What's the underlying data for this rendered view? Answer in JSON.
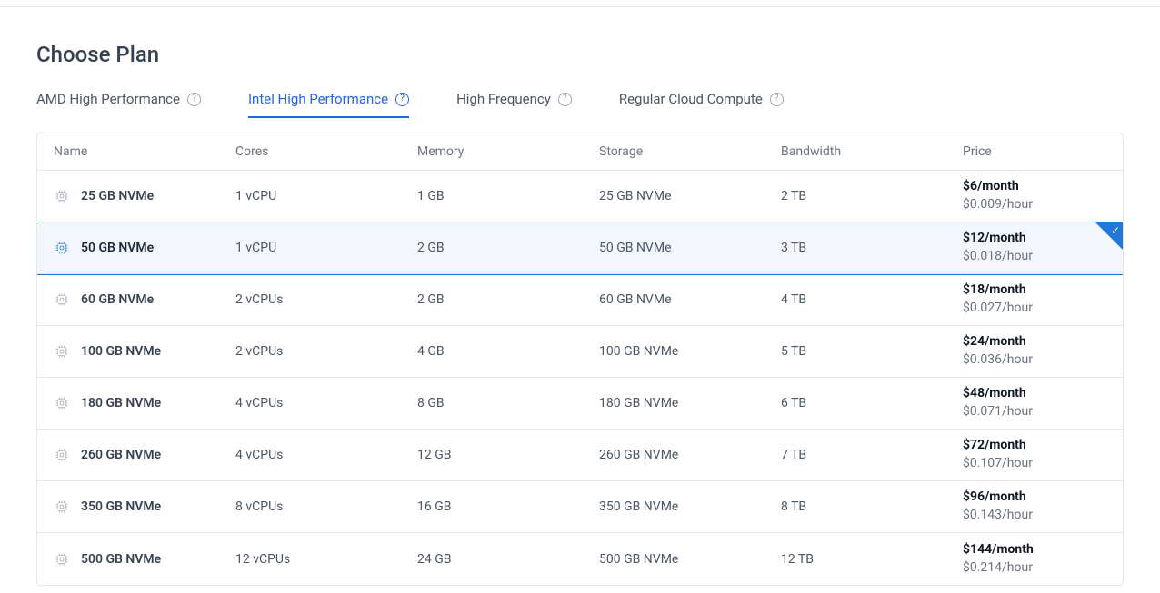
{
  "heading": "Choose Plan",
  "tabs": [
    {
      "label": "AMD High Performance",
      "active": false
    },
    {
      "label": "Intel High Performance",
      "active": true
    },
    {
      "label": "High Frequency",
      "active": false
    },
    {
      "label": "Regular Cloud Compute",
      "active": false
    }
  ],
  "columns": {
    "name": "Name",
    "cores": "Cores",
    "memory": "Memory",
    "storage": "Storage",
    "bandwidth": "Bandwidth",
    "price": "Price"
  },
  "plans": [
    {
      "name": "25 GB NVMe",
      "cores": "1 vCPU",
      "memory": "1 GB",
      "storage": "25 GB NVMe",
      "bandwidth": "2 TB",
      "price_month": "$6/month",
      "price_hour": "$0.009/hour",
      "selected": false
    },
    {
      "name": "50 GB NVMe",
      "cores": "1 vCPU",
      "memory": "2 GB",
      "storage": "50 GB NVMe",
      "bandwidth": "3 TB",
      "price_month": "$12/month",
      "price_hour": "$0.018/hour",
      "selected": true
    },
    {
      "name": "60 GB NVMe",
      "cores": "2 vCPUs",
      "memory": "2 GB",
      "storage": "60 GB NVMe",
      "bandwidth": "4 TB",
      "price_month": "$18/month",
      "price_hour": "$0.027/hour",
      "selected": false
    },
    {
      "name": "100 GB NVMe",
      "cores": "2 vCPUs",
      "memory": "4 GB",
      "storage": "100 GB NVMe",
      "bandwidth": "5 TB",
      "price_month": "$24/month",
      "price_hour": "$0.036/hour",
      "selected": false
    },
    {
      "name": "180 GB NVMe",
      "cores": "4 vCPUs",
      "memory": "8 GB",
      "storage": "180 GB NVMe",
      "bandwidth": "6 TB",
      "price_month": "$48/month",
      "price_hour": "$0.071/hour",
      "selected": false
    },
    {
      "name": "260 GB NVMe",
      "cores": "4 vCPUs",
      "memory": "12 GB",
      "storage": "260 GB NVMe",
      "bandwidth": "7 TB",
      "price_month": "$72/month",
      "price_hour": "$0.107/hour",
      "selected": false
    },
    {
      "name": "350 GB NVMe",
      "cores": "8 vCPUs",
      "memory": "16 GB",
      "storage": "350 GB NVMe",
      "bandwidth": "8 TB",
      "price_month": "$96/month",
      "price_hour": "$0.143/hour",
      "selected": false
    },
    {
      "name": "500 GB NVMe",
      "cores": "12 vCPUs",
      "memory": "24 GB",
      "storage": "500 GB NVMe",
      "bandwidth": "12 TB",
      "price_month": "$144/month",
      "price_hour": "$0.214/hour",
      "selected": false
    }
  ]
}
